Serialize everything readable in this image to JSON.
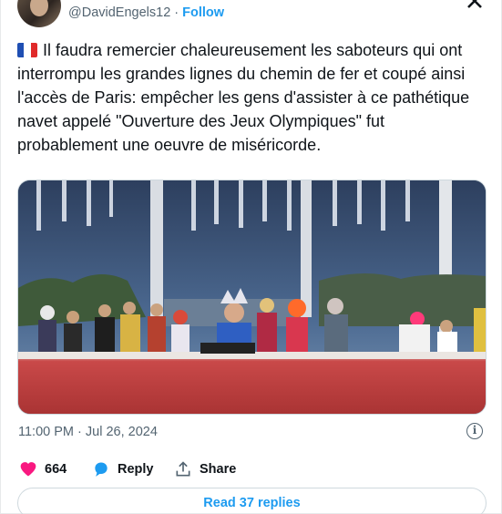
{
  "author": {
    "handle": "@DavidEngels12",
    "separator": "·",
    "follow_label": "Follow"
  },
  "close_icon": "x-icon",
  "tweet": {
    "flag_icon": "france-flag-icon",
    "text": "Il faudra remercier chaleureusement les saboteurs qui ont interrompu les grandes lignes du chemin de fer et coupé ainsi l'accès de Paris: empêcher les gens d'assister à ce pathétique navet appelé \"Ouverture des Jeux Olympiques\" fut probablement une oeuvre de miséricorde."
  },
  "media": {
    "icon": "photo-last-supper-scene"
  },
  "timestamp": "11:00 PM · Jul 26, 2024",
  "actions": {
    "like_count": "664",
    "reply_label": "Reply",
    "share_label": "Share"
  },
  "read_replies_label": "Read 37 replies",
  "colors": {
    "accent": "#1d9bf0",
    "like": "#f91880",
    "text": "#0f1419",
    "muted": "#536471"
  }
}
